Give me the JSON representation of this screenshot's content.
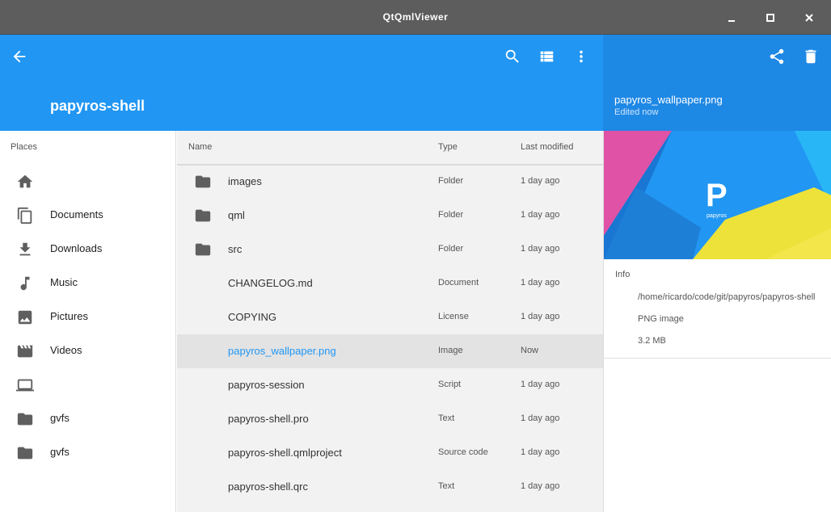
{
  "window": {
    "title": "QtQmlViewer"
  },
  "toolbar": {
    "folder_title": "papyros-shell"
  },
  "detail": {
    "file_name": "papyros_wallpaper.png",
    "status": "Edited now",
    "preview_letter": "P",
    "preview_caption": "papyros",
    "info_heading": "Info",
    "path": "/home/ricardo/code/git/papyros/papyros-shell",
    "file_type": "PNG image",
    "size": "3.2 MB"
  },
  "sidebar": {
    "heading": "Places",
    "items": [
      {
        "icon": "home-icon",
        "label": ""
      },
      {
        "icon": "documents-icon",
        "label": "Documents"
      },
      {
        "icon": "download-icon",
        "label": "Downloads"
      },
      {
        "icon": "music-icon",
        "label": "Music"
      },
      {
        "icon": "image-icon",
        "label": "Pictures"
      },
      {
        "icon": "video-icon",
        "label": "Videos"
      },
      {
        "icon": "laptop-icon",
        "label": ""
      },
      {
        "icon": "folder-icon",
        "label": "gvfs"
      },
      {
        "icon": "folder-icon",
        "label": "gvfs"
      }
    ]
  },
  "files": {
    "columns": {
      "name": "Name",
      "type": "Type",
      "modified": "Last modified"
    },
    "rows": [
      {
        "name": "images",
        "type": "Folder",
        "modified": "1 day ago",
        "icon": "folder-icon"
      },
      {
        "name": "qml",
        "type": "Folder",
        "modified": "1 day ago",
        "icon": "folder-icon"
      },
      {
        "name": "src",
        "type": "Folder",
        "modified": "1 day ago",
        "icon": "folder-icon"
      },
      {
        "name": "CHANGELOG.md",
        "type": "Document",
        "modified": "1 day ago"
      },
      {
        "name": "COPYING",
        "type": "License",
        "modified": "1 day ago"
      },
      {
        "name": "papyros_wallpaper.png",
        "type": "Image",
        "modified": "Now"
      },
      {
        "name": "papyros-session",
        "type": "Script",
        "modified": "1 day ago"
      },
      {
        "name": "papyros-shell.pro",
        "type": "Text",
        "modified": "1 day ago"
      },
      {
        "name": "papyros-shell.qmlproject",
        "type": "Source code",
        "modified": "1 day ago"
      },
      {
        "name": "papyros-shell.qrc",
        "type": "Text",
        "modified": "1 day ago"
      }
    ]
  },
  "colors": {
    "accent": "#2196f3",
    "detail_header": "#1e88e5",
    "titlebar": "#5d5d5d"
  }
}
